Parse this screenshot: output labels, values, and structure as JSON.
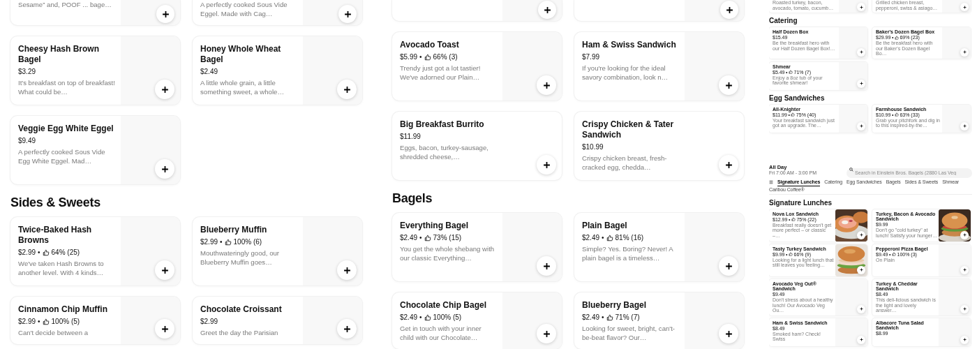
{
  "views": [
    {
      "sections": [
        {
          "items": [
            {
              "kind": "cut",
              "desc": "Sesame” and, POOF ... bage…"
            },
            {
              "kind": "cut",
              "desc": "A perfectly cooked Sous Vide Eggel. Made with Cag…"
            },
            {
              "kind": "plain",
              "name": "Cheesy Hash Brown Bagel",
              "price": "$3.29",
              "desc": "It's breakfast on top of breakfast! What could be…"
            },
            {
              "kind": "plain",
              "name": "Honey Whole Wheat Bagel",
              "price": "$2.49",
              "desc": "A little whole grain, a little something sweet, a whole…"
            },
            {
              "kind": "plain",
              "name": "Veggie Egg White Eggel",
              "price": "$9.49",
              "desc": "A perfectly cooked Sous Vide Egg White Eggel. Mad…"
            }
          ]
        },
        {
          "heading": "Sides & Sweets",
          "items": [
            {
              "kind": "plain",
              "name": "Twice-Baked Hash Browns",
              "price": "$2.99",
              "separator": "•",
              "rating": "64% (25)",
              "desc": "We've taken Hash Browns to another level. With 4 kinds…"
            },
            {
              "kind": "plain",
              "name": "Blueberry Muffin",
              "price": "$2.99",
              "separator": "•",
              "rating": "100% (6)",
              "desc": "Mouthwateringly good, our Blueberry Muffin goes…"
            },
            {
              "kind": "plain",
              "name": "Cinnamon Chip Muffin",
              "price": "$2.99",
              "separator": "•",
              "rating": "100% (5)",
              "desc": "Can't decide between a"
            },
            {
              "kind": "plain",
              "name": "Chocolate Croissant",
              "price": "$2.99",
              "desc": "Greet the day the Parisian"
            }
          ]
        }
      ]
    },
    {
      "sections": [
        {
          "items": [
            {
              "kind": "cut"
            },
            {
              "kind": "cut"
            },
            {
              "kind": "plain",
              "name": "Avocado Toast",
              "price": "$5.99",
              "separator": "•",
              "rating": "66% (3)",
              "desc": "Trendy just got a lot tastier! We've adorned our Plain…"
            },
            {
              "kind": "plain",
              "name": "Ham & Swiss Sandwich",
              "price": "$7.99",
              "desc": "If you're looking for the ideal savory combination, look n…"
            },
            {
              "kind": "bare",
              "name": "Big Breakfast Burrito",
              "price": "$11.99",
              "desc": "Eggs, bacon, turkey-sausage, shredded cheese,…"
            },
            {
              "kind": "bare",
              "name": "Crispy Chicken & Tater Sandwich",
              "price": "$10.99",
              "desc": "Crispy chicken breast, fresh-cracked egg, chedda…"
            }
          ]
        },
        {
          "heading": "Bagels",
          "items": [
            {
              "kind": "plain",
              "name": "Everything Bagel",
              "price": "$2.49",
              "separator": "•",
              "rating": "73% (15)",
              "desc": "You get the whole shebang with our classic Everything…"
            },
            {
              "kind": "plain",
              "name": "Plain Bagel",
              "price": "$2.49",
              "separator": "•",
              "rating": "81% (16)",
              "desc": "Simple? Yes. Boring? Never! A plain bagel is a timeless…"
            },
            {
              "kind": "plain",
              "name": "Chocolate Chip Bagel",
              "price": "$2.49",
              "separator": "•",
              "rating": "100% (5)",
              "desc": "Get in touch with your inner child with our Chocolate…"
            },
            {
              "kind": "plain",
              "name": "Blueberry Bagel",
              "price": "$2.49",
              "separator": "•",
              "rating": "71% (7)",
              "desc": "Looking for sweet, bright, can't-be-beat flavor? Our…"
            }
          ]
        }
      ]
    }
  ],
  "mini_views": [
    {
      "sections": [
        {
          "items": [
            {
              "kind": "cut",
              "desc": "Roasted turkey, bacon, avocado, tomato, cucumb…"
            },
            {
              "kind": "cut",
              "desc": "Grilled chicken breast, pepperoni, swiss & asiago…"
            }
          ]
        },
        {
          "heading": "Catering",
          "items": [
            {
              "kind": "plain",
              "name": "Half Dozen Box",
              "price": "$15.49",
              "desc": "Be the breakfast hero with our Half Dozen Bagel Box!…"
            },
            {
              "kind": "plain",
              "name": "Baker's Dozen Bagel Box",
              "price": "$29.99",
              "separator": "•",
              "rating": "69% (23)",
              "desc": "Be the breakfast hero with our Baker's Dozen Bagel Bo…"
            },
            {
              "kind": "plain",
              "name": "Shmear",
              "price": "$5.49",
              "separator": "•",
              "rating": "71% (7)",
              "desc": "Enjoy a 8oz tub of your favorite shmear!"
            }
          ]
        },
        {
          "heading": "Egg Sandwiches",
          "items": [
            {
              "kind": "plain",
              "name": "All-Knighter",
              "price": "$11.99",
              "separator": "•",
              "rating": "75% (40)",
              "desc": "Your breakfast sandwich just got an upgrade. The…"
            },
            {
              "kind": "plain",
              "name": "Farmhouse Sandwich",
              "price": "$10.99",
              "separator": "•",
              "rating": "63% (33)",
              "desc": "Grab your pitchfork and dig in to this inspired-by-the…"
            }
          ]
        }
      ]
    },
    {
      "header": {
        "title": "All Day",
        "hours": "Fri 7:00 AM - 3:00 PM",
        "search": {
          "placeholder": "Search in Einstein Bros. Bagels (2880 Las Veg"
        },
        "tabs": [
          {
            "label": "Signature Lunches",
            "selected": true
          },
          {
            "label": "Catering",
            "selected": false
          },
          {
            "label": "Egg Sandwiches",
            "selected": false
          },
          {
            "label": "Bagels",
            "selected": false
          },
          {
            "label": "Sides & Sweets",
            "selected": false
          },
          {
            "label": "Shmear",
            "selected": false
          },
          {
            "label": "Caribou Coffee®",
            "selected": false
          }
        ]
      },
      "sections": [
        {
          "heading": "Signature Lunches",
          "items": [
            {
              "name": "Nova Lox Sandwich",
              "price": "$12.99",
              "separator": "•",
              "rating": "75% (22)",
              "desc": "Breakfast really doesn't get more perfect – or classic –…"
            },
            {
              "name": "Turkey, Bacon & Avocado Sandwich",
              "price": "$9.99",
              "desc": "Don't go \"cold turkey\" at lunch! Satisfy your hunger…"
            },
            {
              "name": "Tasty Turkey Sandwich",
              "price": "$9.99",
              "separator": "•",
              "rating": "66% (9)",
              "desc": "Looking for a light lunch that still leaves you feeling…"
            },
            {
              "kind": "plain",
              "name": "Pepperoni Pizza Bagel",
              "price": "$9.49",
              "separator": "•",
              "rating": "100% (3)",
              "desc": "On Plain"
            },
            {
              "kind": "plain",
              "name": "Avocado Veg Out® Sandwich",
              "price": "$9.49",
              "desc": "Don't stress about a healthy lunch! Our Avocado Veg Ou…"
            },
            {
              "kind": "plain",
              "name": "Turkey & Cheddar Sandwich",
              "price": "$8.49",
              "desc": "This deli-licious sandwich is the light and lovely answer…"
            },
            {
              "kind": "plain",
              "name": "Ham & Swiss Sandwich",
              "price": "$8.49",
              "desc": "Smoked ham? Check! Swiss"
            },
            {
              "kind": "plain",
              "name": "Albacore Tuna Salad Sandwich",
              "price": "$8.99"
            }
          ]
        }
      ]
    }
  ]
}
